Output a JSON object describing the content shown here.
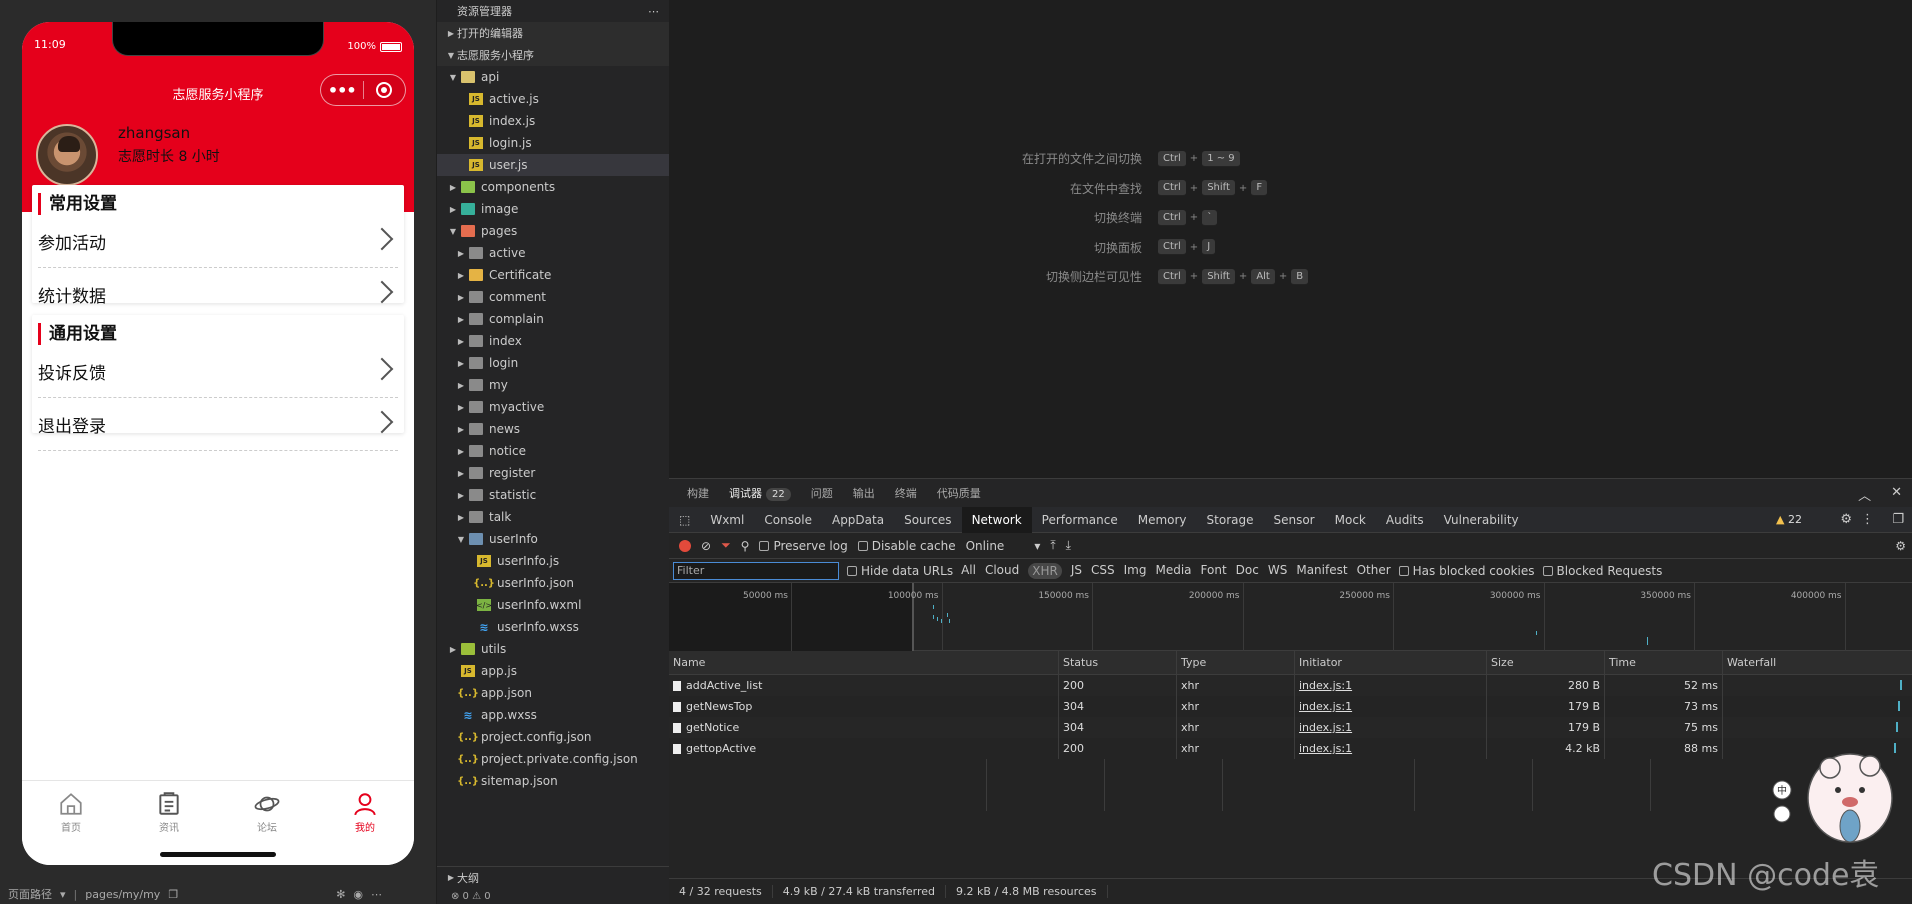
{
  "simulator": {
    "status_time": "11:09",
    "battery": "100%",
    "nav_title": "志愿服务小程序",
    "user_name": "zhangsan",
    "user_hours": "志愿时长 8 小时",
    "section1_title": "常用设置",
    "section1_items": [
      "参加活动",
      "统计数据"
    ],
    "section2_title": "通用设置",
    "section2_items": [
      "投诉反馈",
      "退出登录"
    ],
    "tabs": [
      {
        "label": "首页",
        "icon": "home-icon"
      },
      {
        "label": "资讯",
        "icon": "news-icon"
      },
      {
        "label": "论坛",
        "icon": "planet-icon"
      },
      {
        "label": "我的",
        "icon": "person-icon"
      }
    ],
    "active_tab": "我的",
    "accent": "#e5001b",
    "footer_path_label": "页面路径",
    "footer_path": "pages/my/my"
  },
  "explorer": {
    "title": "资源管理器",
    "open_editors": "打开的编辑器",
    "project": "志愿服务小程序",
    "tree": [
      {
        "name": "api",
        "depth": 1,
        "type": "folder-api",
        "open": true
      },
      {
        "name": "active.js",
        "depth": 2,
        "type": "js"
      },
      {
        "name": "index.js",
        "depth": 2,
        "type": "js"
      },
      {
        "name": "login.js",
        "depth": 2,
        "type": "js"
      },
      {
        "name": "user.js",
        "depth": 2,
        "type": "js",
        "selected": true
      },
      {
        "name": "components",
        "depth": 1,
        "type": "folder-comp"
      },
      {
        "name": "image",
        "depth": 1,
        "type": "folder-img"
      },
      {
        "name": "pages",
        "depth": 1,
        "type": "folder-pages",
        "open": true
      },
      {
        "name": "active",
        "depth": 2,
        "type": "folder"
      },
      {
        "name": "Certificate",
        "depth": 2,
        "type": "folder-cert"
      },
      {
        "name": "comment",
        "depth": 2,
        "type": "folder"
      },
      {
        "name": "complain",
        "depth": 2,
        "type": "folder"
      },
      {
        "name": "index",
        "depth": 2,
        "type": "folder"
      },
      {
        "name": "login",
        "depth": 2,
        "type": "folder"
      },
      {
        "name": "my",
        "depth": 2,
        "type": "folder"
      },
      {
        "name": "myactive",
        "depth": 2,
        "type": "folder"
      },
      {
        "name": "news",
        "depth": 2,
        "type": "folder"
      },
      {
        "name": "notice",
        "depth": 2,
        "type": "folder"
      },
      {
        "name": "register",
        "depth": 2,
        "type": "folder"
      },
      {
        "name": "statistic",
        "depth": 2,
        "type": "folder"
      },
      {
        "name": "talk",
        "depth": 2,
        "type": "folder"
      },
      {
        "name": "userInfo",
        "depth": 2,
        "type": "folder-user",
        "open": true
      },
      {
        "name": "userInfo.js",
        "depth": 3,
        "type": "js"
      },
      {
        "name": "userInfo.json",
        "depth": 3,
        "type": "json"
      },
      {
        "name": "userInfo.wxml",
        "depth": 3,
        "type": "wxml"
      },
      {
        "name": "userInfo.wxss",
        "depth": 3,
        "type": "wxss"
      },
      {
        "name": "utils",
        "depth": 1,
        "type": "folder-utils"
      },
      {
        "name": "app.js",
        "depth": 1,
        "type": "js"
      },
      {
        "name": "app.json",
        "depth": 1,
        "type": "json"
      },
      {
        "name": "app.wxss",
        "depth": 1,
        "type": "wxss"
      },
      {
        "name": "project.config.json",
        "depth": 1,
        "type": "json"
      },
      {
        "name": "project.private.config.json",
        "depth": 1,
        "type": "json"
      },
      {
        "name": "sitemap.json",
        "depth": 1,
        "type": "json"
      }
    ],
    "outline": "大纲",
    "status": "⊗ 0 ⚠ 0"
  },
  "editor": {
    "shortcuts": [
      {
        "label": "在打开的文件之间切换",
        "keys": [
          "Ctrl",
          "1 ~ 9"
        ]
      },
      {
        "label": "在文件中查找",
        "keys": [
          "Ctrl",
          "Shift",
          "F"
        ]
      },
      {
        "label": "切换终端",
        "keys": [
          "Ctrl",
          "`"
        ]
      },
      {
        "label": "切换面板",
        "keys": [
          "Ctrl",
          "J"
        ]
      },
      {
        "label": "切换侧边栏可见性",
        "keys": [
          "Ctrl",
          "Shift",
          "Alt",
          "B"
        ]
      }
    ]
  },
  "devtools": {
    "panel_tabs": [
      "构建",
      "调试器",
      "问题",
      "输出",
      "终端",
      "代码质量"
    ],
    "debugger_badge": "22",
    "tabs": [
      "Wxml",
      "Console",
      "AppData",
      "Sources",
      "Network",
      "Performance",
      "Memory",
      "Storage",
      "Sensor",
      "Mock",
      "Audits",
      "Vulnerability"
    ],
    "active_tab": "Network",
    "warnings": "22",
    "preserve_log": "Preserve log",
    "disable_cache": "Disable cache",
    "throttle": "Online",
    "filter_placeholder": "Filter",
    "hide_data_urls": "Hide data URLs",
    "types": [
      "All",
      "Cloud",
      "XHR",
      "JS",
      "CSS",
      "Img",
      "Media",
      "Font",
      "Doc",
      "WS",
      "Manifest",
      "Other"
    ],
    "active_type": "XHR",
    "has_blocked": "Has blocked cookies",
    "blocked_requests": "Blocked Requests",
    "overview_labels": [
      "50000 ms",
      "100000 ms",
      "150000 ms",
      "200000 ms",
      "250000 ms",
      "300000 ms",
      "350000 ms",
      "400000 ms"
    ],
    "columns": [
      "Name",
      "Status",
      "Type",
      "Initiator",
      "Size",
      "Time",
      "Waterfall"
    ],
    "rows": [
      {
        "name": "addActive_list",
        "status": "200",
        "type": "xhr",
        "initiator": "index.js:1",
        "size": "280 B",
        "time": "52 ms"
      },
      {
        "name": "getNewsTop",
        "status": "304",
        "type": "xhr",
        "initiator": "index.js:1",
        "size": "179 B",
        "time": "73 ms"
      },
      {
        "name": "getNotice",
        "status": "304",
        "type": "xhr",
        "initiator": "index.js:1",
        "size": "179 B",
        "time": "75 ms"
      },
      {
        "name": "gettopActive",
        "status": "200",
        "type": "xhr",
        "initiator": "index.js:1",
        "size": "4.2 kB",
        "time": "88 ms"
      }
    ],
    "summary": [
      "4 / 32 requests",
      "4.9 kB / 27.4 kB transferred",
      "9.2 kB / 4.8 MB resources"
    ]
  },
  "watermark": "CSDN @code袁"
}
